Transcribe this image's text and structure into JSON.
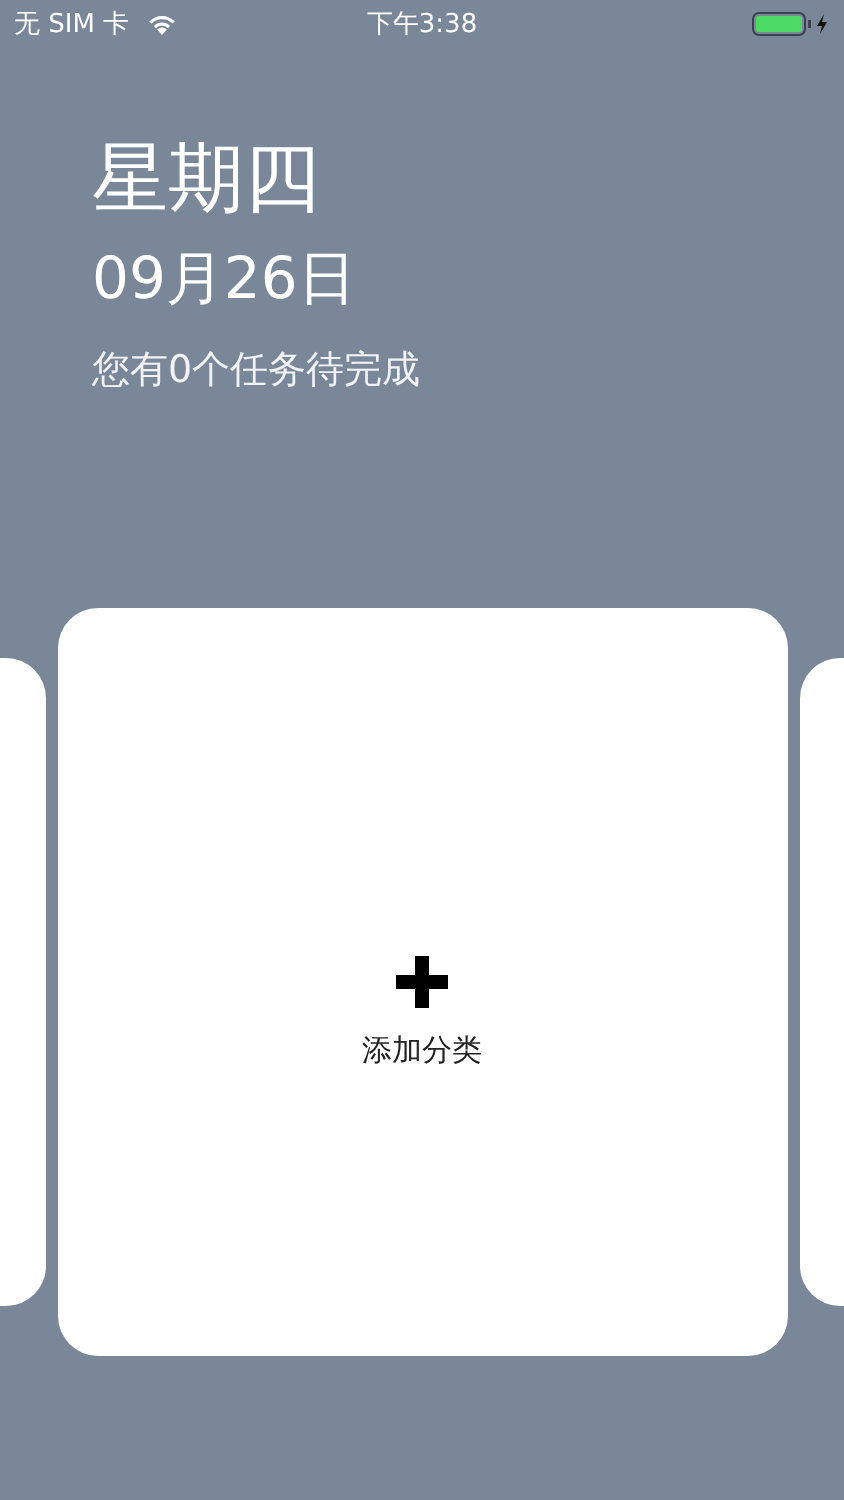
{
  "status_bar": {
    "carrier": "无 SIM 卡",
    "time": "下午3:38"
  },
  "header": {
    "weekday": "星期四",
    "date": "09月26日",
    "summary": "您有0个任务待完成"
  },
  "cards": [
    {
      "kind": "peek"
    },
    {
      "kind": "add",
      "label": "添加分类"
    },
    {
      "kind": "peek"
    }
  ]
}
